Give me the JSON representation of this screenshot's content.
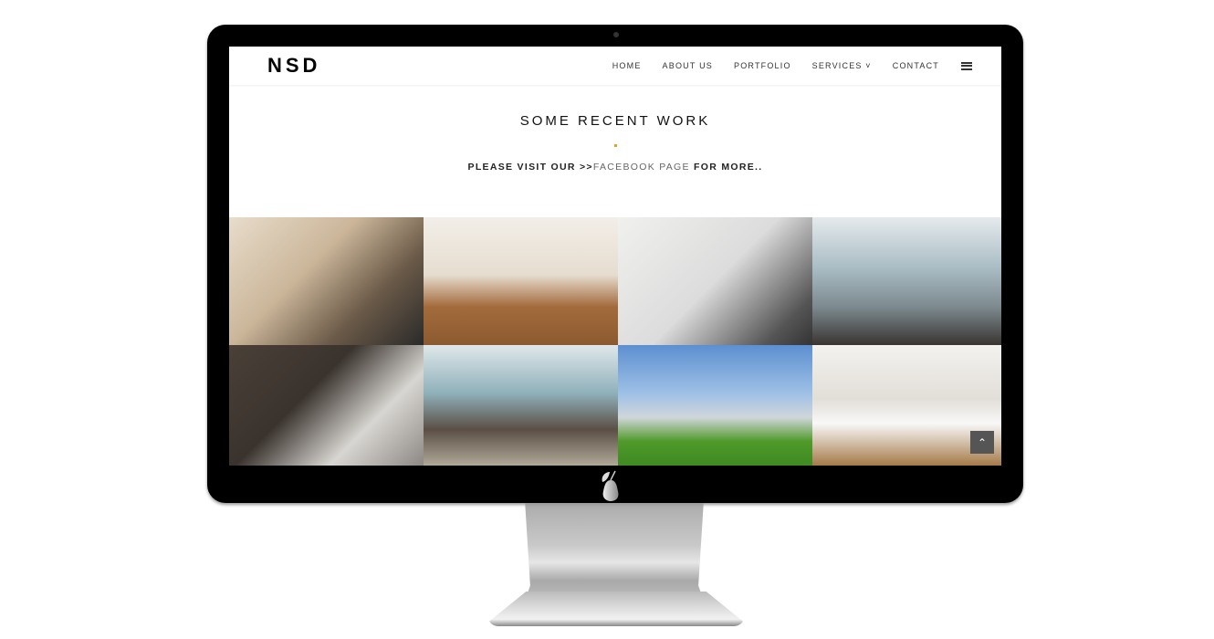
{
  "site": {
    "brand": "NSD"
  },
  "nav": {
    "items": [
      "HOME",
      "ABOUT US",
      "PORTFOLIO",
      "SERVICES ˅",
      "CONTACT"
    ],
    "menu_icon": "hamburger-icon"
  },
  "section": {
    "title": "SOME RECENT WORK",
    "subtitle_prefix": "PLEASE VISIT OUR >>",
    "subtitle_link": "FACEBOOK PAGE",
    "subtitle_suffix": " FOR MORE.."
  },
  "colors": {
    "accent": "#e8a21a"
  },
  "gallery": [
    {
      "name": "bunk-bedroom",
      "bg": "linear-gradient(135deg,#e8dccb 0%,#cbb69a 40%,#6b5a48 70%,#2a2a2a 100%)"
    },
    {
      "name": "bathroom-vanity",
      "bg": "linear-gradient(180deg,#f2eee8 0%,#e6ddd0 45%,#a36b3c 70%,#8c5a30 100%)"
    },
    {
      "name": "bathroom-bathtub",
      "bg": "linear-gradient(135deg,#f0f0ee 0%,#dcdcdc 50%,#555 85%,#333 100%)"
    },
    {
      "name": "twin-bedroom",
      "bg": "linear-gradient(180deg,#e5eaec 0%,#a9bcc4 40%,#7d8a8f 70%,#3a3532 100%)"
    },
    {
      "name": "living-room-tv",
      "bg": "linear-gradient(135deg,#4a4038 0%,#3a332d 40%,#d8d6d2 70%,#8d8884 100%)"
    },
    {
      "name": "living-room-sofa",
      "bg": "linear-gradient(180deg,#dfe8ea 0%,#8fb0ba 40%,#5b4f45 70%,#b0a898 100%)"
    },
    {
      "name": "house-exterior",
      "bg": "linear-gradient(180deg,#5d8fd0 0%,#9ec0e6 40%,#d0d6da 60%,#4f9a2a 80%,#3f8a22 100%)"
    },
    {
      "name": "kitchen",
      "bg": "linear-gradient(180deg,#f3f2ef 0%,#e2ded8 45%,#f8f8f8 65%,#a57a48 100%)"
    }
  ],
  "scroll_top": {
    "label": "⌃",
    "icon": "double-chevron-up-icon"
  }
}
